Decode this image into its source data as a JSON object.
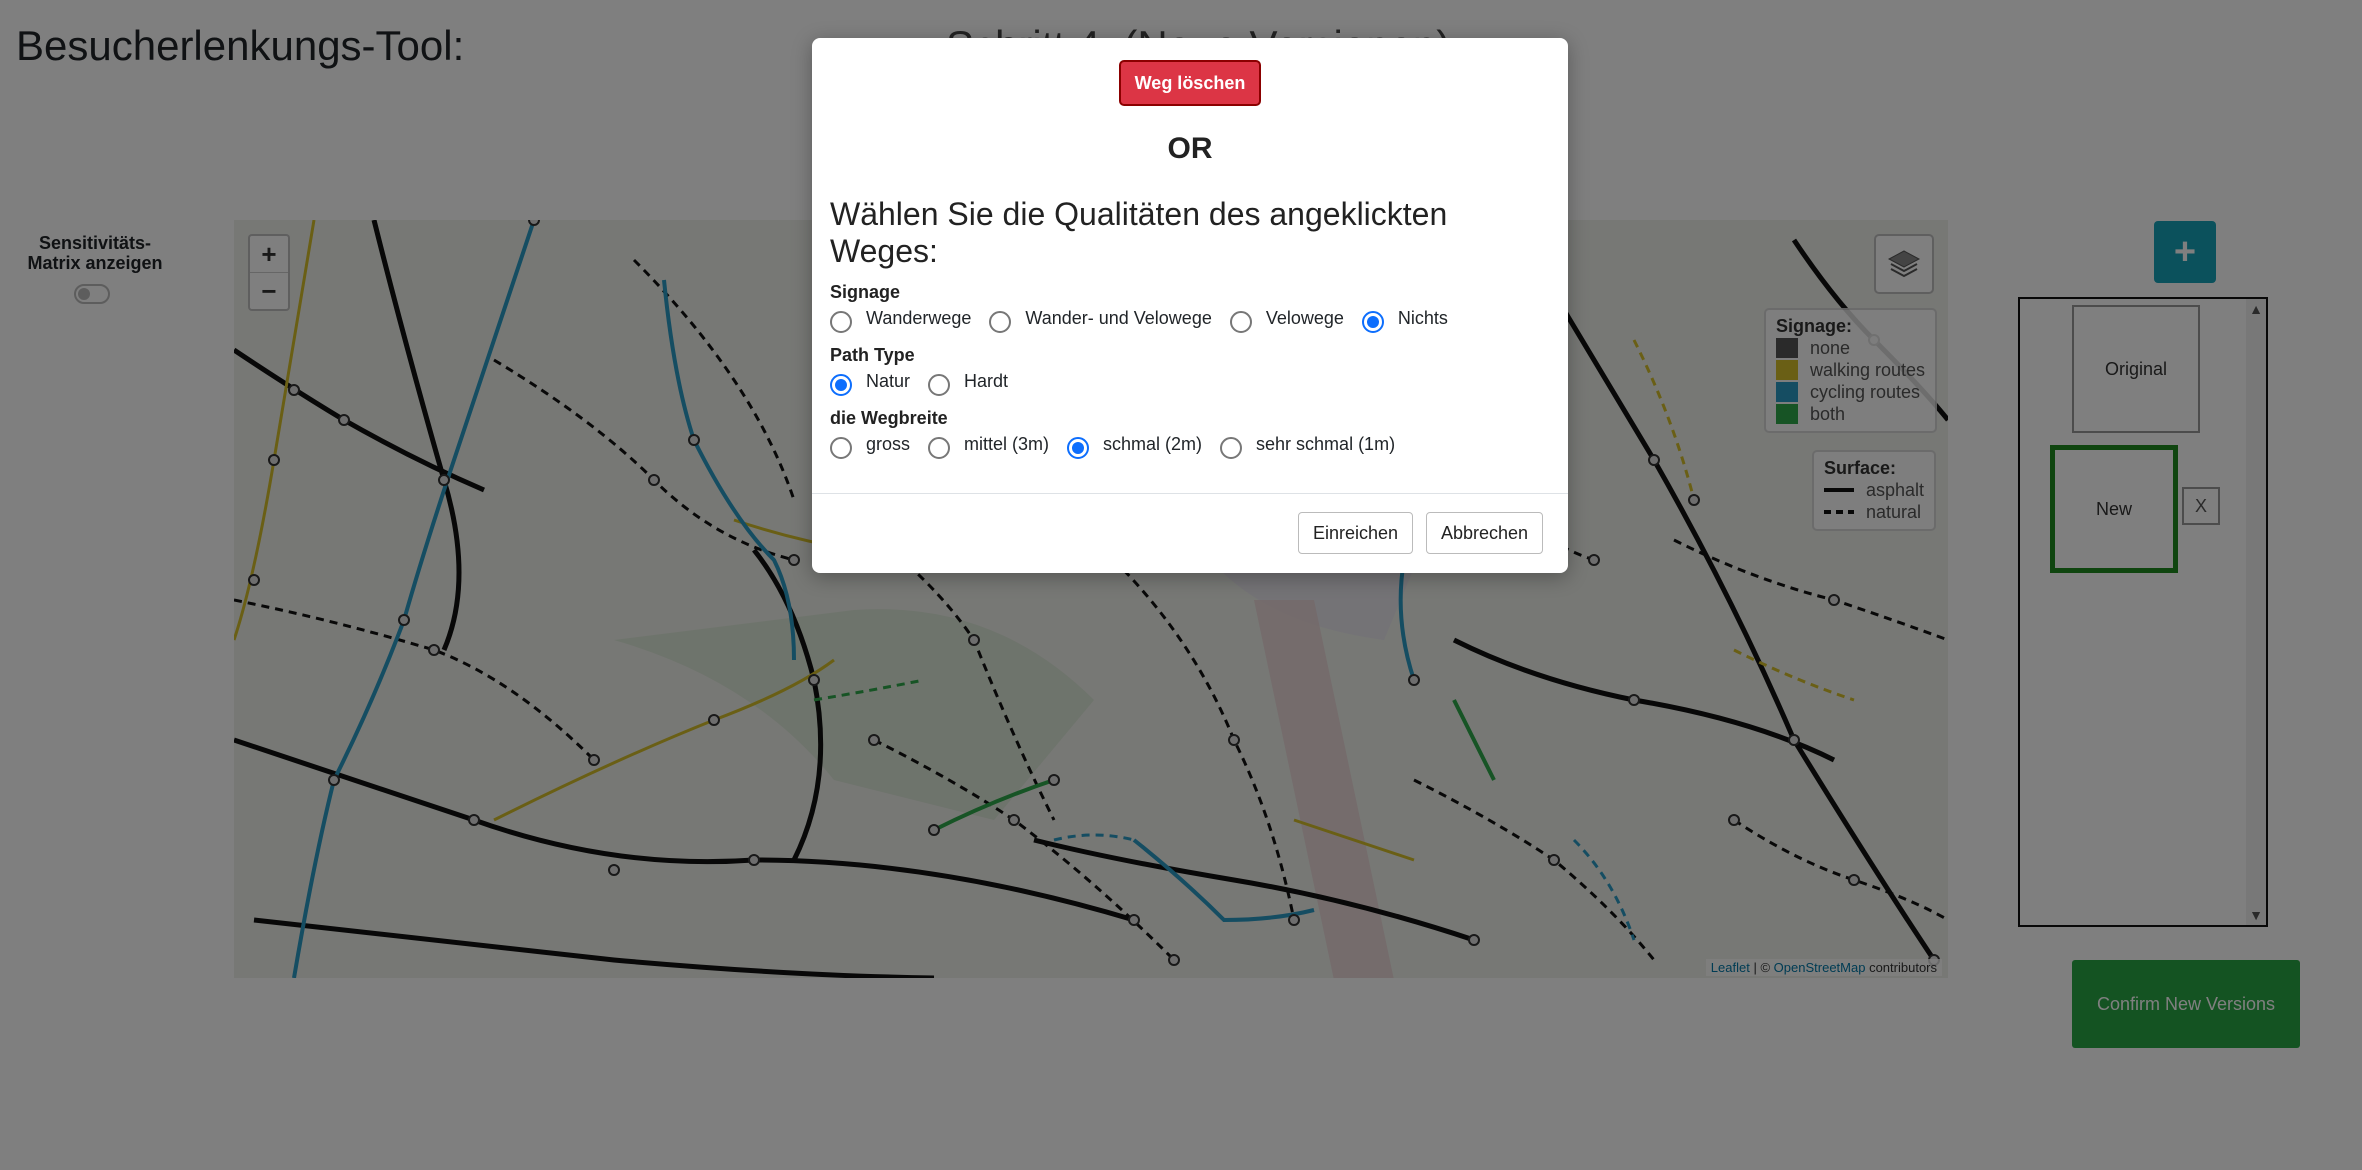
{
  "page": {
    "title": "Besucherlenkungs-Tool:",
    "step_title": "Schritt 4: (Neue Versionen)"
  },
  "sidebar": {
    "sensitivity_label": "Sensitivitäts-Matrix anzeigen"
  },
  "map": {
    "zoom_in": "+",
    "zoom_out": "−",
    "legend_signage": {
      "title": "Signage:",
      "items": [
        {
          "label": "none",
          "color": "#555555"
        },
        {
          "label": "walking routes",
          "color": "#d4bf2a"
        },
        {
          "label": "cycling routes",
          "color": "#2b9bc4"
        },
        {
          "label": "both",
          "color": "#2ea84a"
        }
      ]
    },
    "legend_surface": {
      "title": "Surface:",
      "items": [
        {
          "label": "asphalt",
          "style": "solid"
        },
        {
          "label": "natural",
          "style": "dashed"
        }
      ]
    },
    "attribution": {
      "leaflet": "Leaflet",
      "separator": "| ©",
      "osm": "OpenStreetMap",
      "suffix": "contributors"
    }
  },
  "versions": {
    "add_label": "+",
    "original_label": "Original",
    "new_label": "New",
    "remove_label": "X",
    "confirm_label": "Confirm New Versions"
  },
  "modal": {
    "delete_label": "Weg löschen",
    "or_label": "OR",
    "question": "Wählen Sie die Qualitäten des angeklickten Weges:",
    "groups": {
      "signage": {
        "label": "Signage",
        "options": [
          "Wanderwege",
          "Wander- und Velowege",
          "Velowege",
          "Nichts"
        ],
        "selected": "Nichts"
      },
      "path_type": {
        "label": "Path Type",
        "options": [
          "Natur",
          "Hardt"
        ],
        "selected": "Natur"
      },
      "width": {
        "label": "die Wegbreite",
        "options": [
          "gross",
          "mittel (3m)",
          "schmal (2m)",
          "sehr schmal (1m)"
        ],
        "selected": "schmal (2m)"
      }
    },
    "submit_label": "Einreichen",
    "cancel_label": "Abbrechen"
  },
  "colors": {
    "delete": "#dc3545",
    "radio_selected": "#0d6efd",
    "add_button": "#17a2b8",
    "confirm_button": "#28a745",
    "new_version_border": "#1f8a1f"
  }
}
